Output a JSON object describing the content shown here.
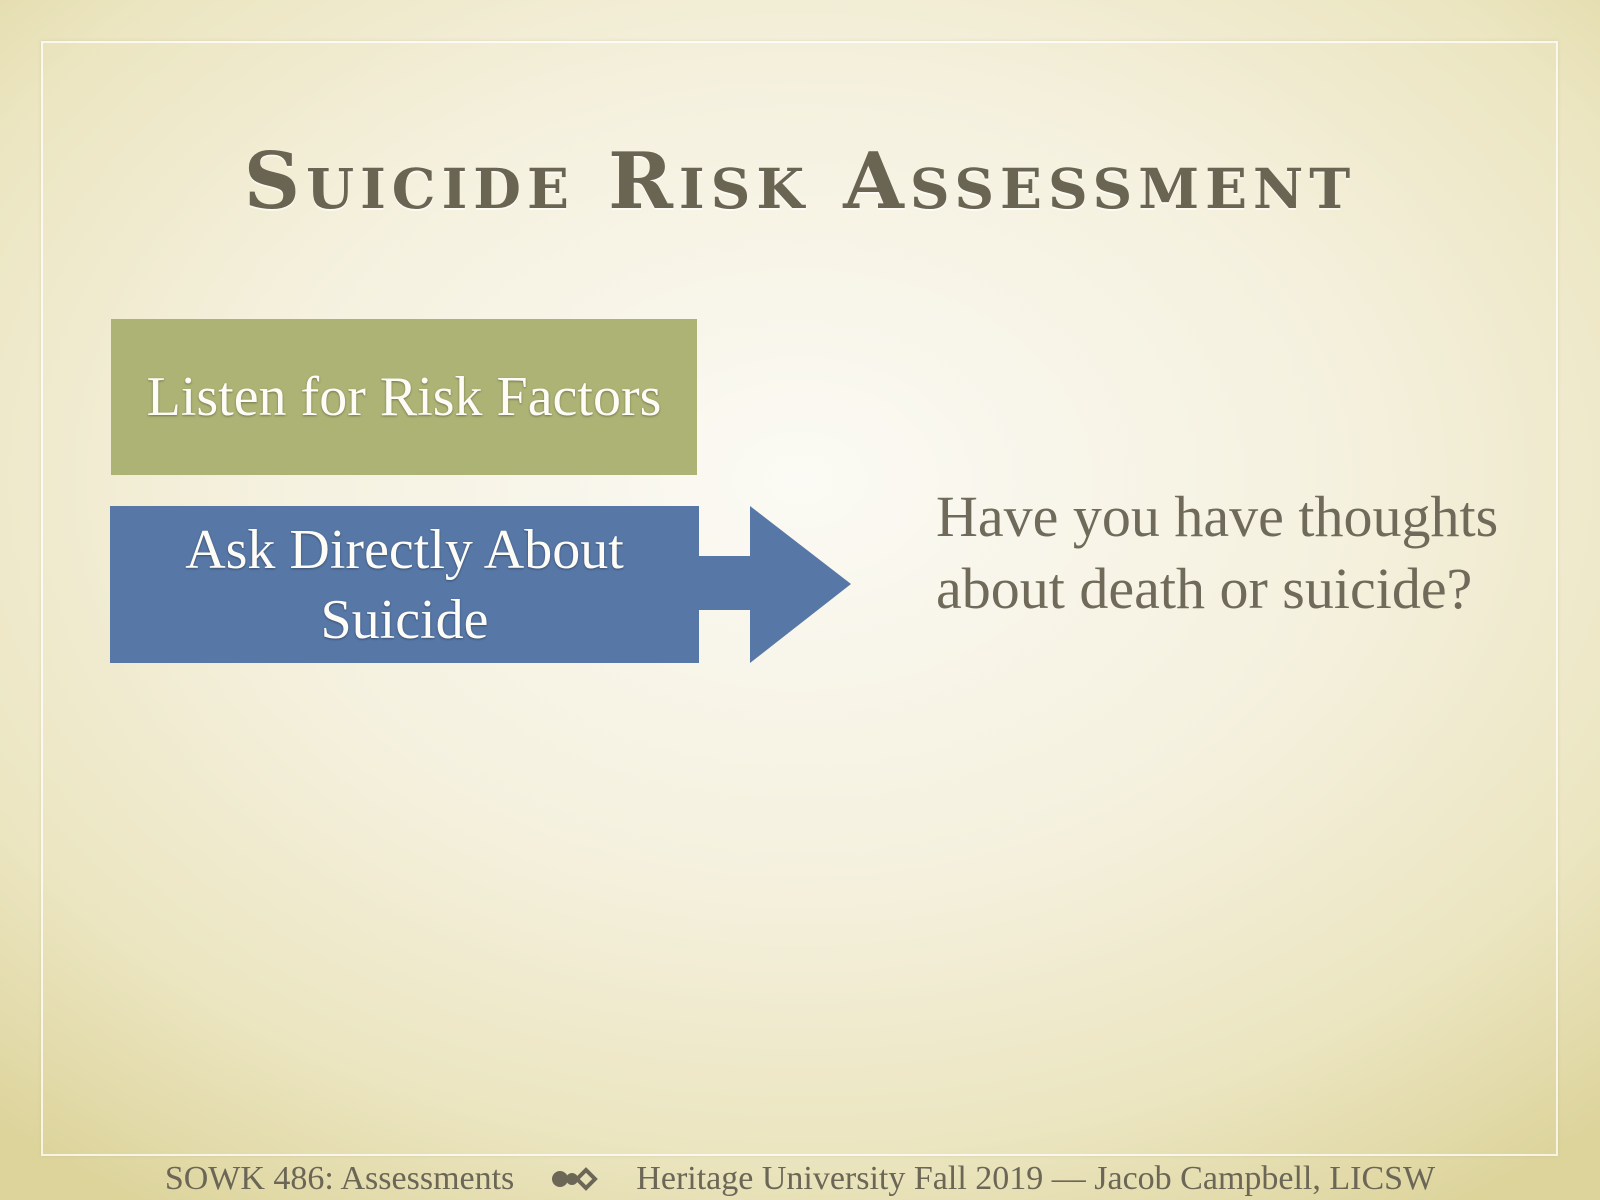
{
  "slide": {
    "title": "Suicide Risk Assessment",
    "boxes": {
      "risk_factors": "Listen for Risk Factors",
      "ask_directly": "Ask Directly About Suicide"
    },
    "question": "Have you have thoughts about death or suicide?",
    "colors": {
      "green_box": "#adb374",
      "blue_box": "#5777a6",
      "text": "#6a6553"
    }
  },
  "footer": {
    "course": "SOWK 486: Assessments",
    "separator_icon": "ornament-icon",
    "credit": "Heritage University Fall 2019 — Jacob Campbell, LICSW"
  }
}
